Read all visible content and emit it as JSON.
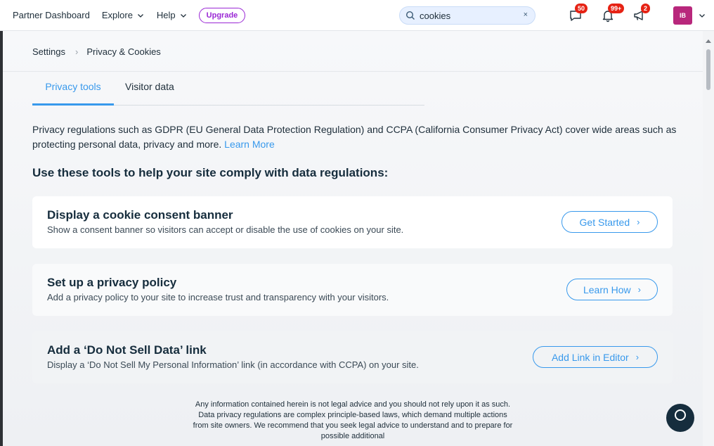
{
  "topbar": {
    "brand": "Partner Dashboard",
    "explore": "Explore",
    "help": "Help",
    "upgrade": "Upgrade",
    "search_value": "cookies",
    "search_clear": "×",
    "messages_badge": "50",
    "notifications_badge": "99+",
    "announcements_badge": "2",
    "avatar_initials": "IB"
  },
  "breadcrumb": {
    "parent": "Settings",
    "separator": "›",
    "current": "Privacy & Cookies"
  },
  "tabs": [
    {
      "label": "Privacy tools",
      "active": true
    },
    {
      "label": "Visitor data",
      "active": false
    }
  ],
  "intro": {
    "text": "Privacy regulations such as GDPR (EU General Data Protection Regulation) and CCPA (California Consumer Privacy Act) cover wide areas such as protecting personal data, privacy and more.",
    "link": "Learn More"
  },
  "heading": "Use these tools to help your site comply with data regulations:",
  "cards": [
    {
      "title": "Display a cookie consent banner",
      "desc": "Show a consent banner so visitors can accept or disable the use of cookies on your site.",
      "button": "Get Started"
    },
    {
      "title": "Set up a privacy policy",
      "desc": "Add a privacy policy to your site to increase trust and transparency with your visitors.",
      "button": "Learn How"
    },
    {
      "title": "Add a ‘Do Not Sell Data’ link",
      "desc": "Display a ‘Do Not Sell My Personal Information’ link (in accordance with CCPA) on your site.",
      "button": "Add Link in Editor"
    }
  ],
  "button_arrow": "›",
  "disclaimer": "Any information contained herein is not legal advice and you should not rely upon it as such. Data privacy regulations are complex principle-based laws, which demand multiple actions from site owners. We recommend that you seek legal advice to understand and to prepare for possible additional",
  "colors": {
    "accent": "#3899ec",
    "upgrade": "#9a27d5",
    "badge": "#e62214",
    "avatar": "#b8277c"
  }
}
